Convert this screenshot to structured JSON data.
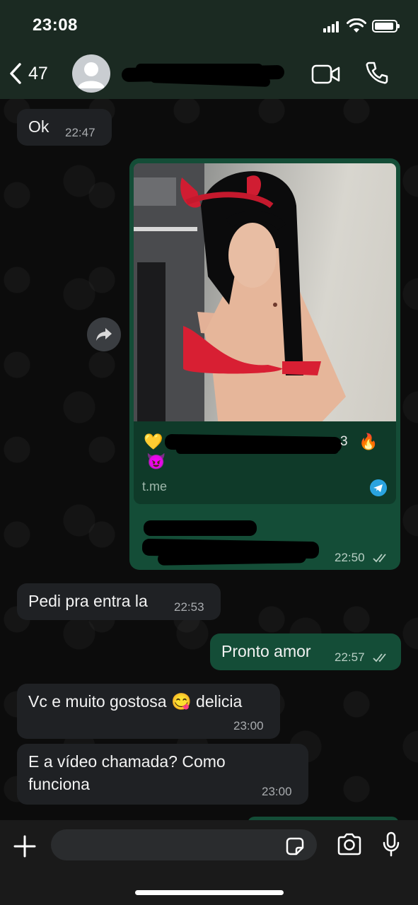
{
  "status_bar": {
    "time": "23:08"
  },
  "header": {
    "back_count": "47"
  },
  "messages": {
    "m1": {
      "text": "Ok",
      "time": "22:47"
    },
    "link": {
      "emoji_start": "💛",
      "emoji_fire": "🔥",
      "emoji_devil": "😈",
      "tail_char": "3",
      "url": "t.me",
      "time": "22:50"
    },
    "m3": {
      "text": "Pedi pra entra la",
      "time": "22:53"
    },
    "m4": {
      "text": "Pronto amor",
      "time": "22:57"
    },
    "m5": {
      "text_before": "Vc e muito gostosa",
      "emoji": "😋",
      "text_after": "delicia",
      "time": "23:00"
    },
    "m6": {
      "line1": "E a vídeo chamada? Como",
      "line2": "funciona",
      "time": "23:00"
    }
  },
  "composer": {
    "placeholder": ""
  },
  "colors": {
    "header_bg": "#1b2a22",
    "incoming_bubble": "#1f2124",
    "outgoing_bubble": "#144d37",
    "link_preview_bg": "#0f3a29",
    "telegram_blue": "#2aa3df"
  },
  "icons": [
    "back-chevron-icon",
    "avatar-placeholder-icon",
    "video-call-icon",
    "phone-icon",
    "forward-icon",
    "telegram-icon",
    "double-check-icon",
    "plus-icon",
    "sticker-icon",
    "camera-icon",
    "microphone-icon"
  ]
}
